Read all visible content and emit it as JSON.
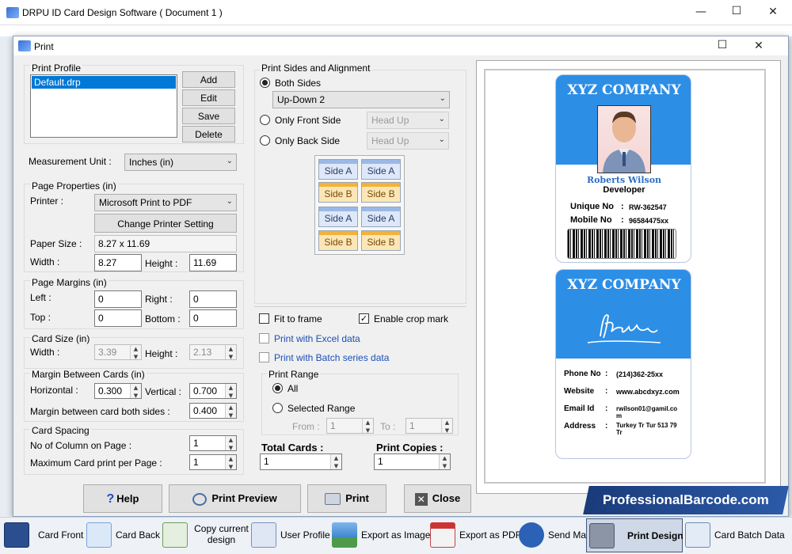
{
  "app": {
    "title": "DRPU ID Card Design Software ( Document 1 )",
    "minimize": "—",
    "maximize": "☐",
    "close": "✕"
  },
  "dialog": {
    "title": "Print",
    "maximize": "☐",
    "close": "✕"
  },
  "print_profile": {
    "group_label": "Print Profile",
    "profiles": [
      "Default.drp"
    ],
    "add": "Add",
    "edit": "Edit",
    "save": "Save",
    "delete": "Delete"
  },
  "measurement": {
    "label": "Measurement Unit :",
    "value": "Inches (in)"
  },
  "page_properties": {
    "group_label": "Page Properties (in)",
    "printer_label": "Printer :",
    "printer": "Microsoft Print to PDF",
    "change_printer": "Change Printer Setting",
    "paper_size_label": "Paper Size :",
    "paper_size": "8.27 x 11.69",
    "width_label": "Width :",
    "width": "8.27",
    "height_label": "Height :",
    "height": "11.69"
  },
  "page_margins": {
    "group_label": "Page Margins (in)",
    "left_label": "Left :",
    "left": "0",
    "right_label": "Right :",
    "right": "0",
    "top_label": "Top :",
    "top": "0",
    "bottom_label": "Bottom :",
    "bottom": "0"
  },
  "card_size": {
    "group_label": "Card Size (in)",
    "width_label": "Width :",
    "width": "3.39",
    "height_label": "Height :",
    "height": "2.13"
  },
  "margin_between": {
    "group_label": "Margin Between Cards (in)",
    "horizontal_label": "Horizontal :",
    "horizontal": "0.300",
    "vertical_label": "Vertical :",
    "vertical": "0.700",
    "both_sides_label": "Margin between card both sides :",
    "both_sides": "0.400"
  },
  "card_spacing": {
    "group_label": "Card Spacing",
    "columns_label": "No of Column on Page :",
    "columns": "1",
    "max_label": "Maximum Card print per Page :",
    "max": "1"
  },
  "sides": {
    "group_label": "Print Sides and Alignment",
    "both_label": "Both Sides",
    "both_value": "Up-Down 2",
    "front_label": "Only Front Side",
    "front_value": "Head Up",
    "back_label": "Only Back Side",
    "back_value": "Head Up",
    "grid": [
      [
        "Side A",
        "Side A"
      ],
      [
        "Side B",
        "Side B"
      ],
      [
        "Side A",
        "Side A"
      ],
      [
        "Side B",
        "Side B"
      ]
    ]
  },
  "options": {
    "fit_to_frame": "Fit to frame",
    "crop_mark": "Enable crop mark",
    "excel": "Print with Excel data",
    "batch": "Print with Batch series data"
  },
  "print_range": {
    "group_label": "Print Range",
    "all": "All",
    "selected": "Selected Range",
    "from_label": "From :",
    "from": "1",
    "to_label": "To :",
    "to": "1"
  },
  "totals": {
    "total_label": "Total Cards :",
    "total": "1",
    "copies_label": "Print Copies :",
    "copies": "1"
  },
  "buttons": {
    "help": "Help",
    "preview": "Print Preview",
    "print": "Print",
    "close": "Close"
  },
  "card_front": {
    "company": "XYZ COMPANY",
    "name": "Roberts Wilson",
    "role": "Developer",
    "unique_label": "Unique No",
    "unique": "RW-362547",
    "mobile_label": "Mobile No",
    "mobile": "96584475xx"
  },
  "card_back": {
    "company": "XYZ COMPANY",
    "phone_label": "Phone No",
    "phone": "(214)362-25xx",
    "website_label": "Website",
    "website": "www.abcdxyz.com",
    "email_label": "Email Id",
    "email": "rwilson01@gamil.com",
    "address_label": "Address",
    "address": "Turkey Tr Tur 513 79 Tr"
  },
  "brand": "ProfessionalBarcode.com",
  "taskbar": [
    {
      "label": "Card Front",
      "icon": "card-front-icon"
    },
    {
      "label": "Card Back",
      "icon": "card-back-icon"
    },
    {
      "label": "Copy current design",
      "icon": "copy-design-icon"
    },
    {
      "label": "User Profile",
      "icon": "user-profile-icon"
    },
    {
      "label": "Export as Image",
      "icon": "export-image-icon"
    },
    {
      "label": "Export as PDF",
      "icon": "export-pdf-icon"
    },
    {
      "label": "Send Mail",
      "icon": "send-mail-icon"
    },
    {
      "label": "Print Design",
      "icon": "print-design-icon"
    },
    {
      "label": "Card Batch Data",
      "icon": "card-batch-icon"
    }
  ]
}
